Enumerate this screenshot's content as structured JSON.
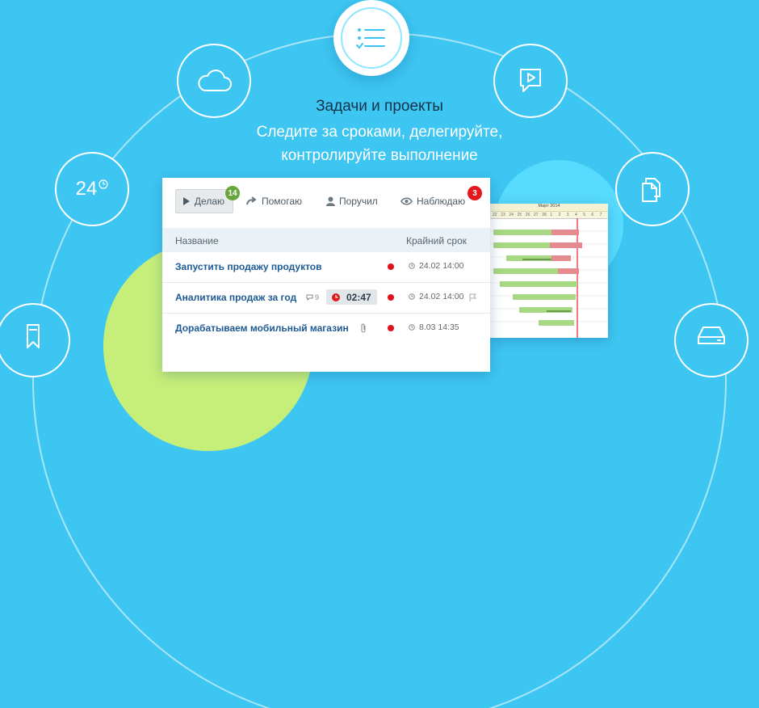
{
  "colors": {
    "background": "#3ec6f2",
    "accent_green": "#c6ef7a",
    "done_badge": "#69a53f",
    "alert_badge": "#e3171c",
    "link": "#1d5a94"
  },
  "feature": {
    "icon": "checklist-icon",
    "title": "Задачи и проекты",
    "subtitle": "Следите за сроками, делегируйте, контролируйте выполнение"
  },
  "nodes": [
    {
      "icon": "cloud-icon"
    },
    {
      "icon": "chat-play-icon"
    },
    {
      "label": "24",
      "icon": "clock-icon"
    },
    {
      "icon": "documents-icon"
    },
    {
      "icon": "bookmark-icon"
    },
    {
      "icon": "drive-icon"
    }
  ],
  "tabs": [
    {
      "label": "Делаю",
      "icon": "play-icon",
      "badge": "14",
      "active": true
    },
    {
      "label": "Помогаю",
      "icon": "arrow-icon"
    },
    {
      "label": "Поручил",
      "icon": "person-icon"
    },
    {
      "label": "Наблюдаю",
      "icon": "eye-icon",
      "badge": "3"
    }
  ],
  "table": {
    "columns": [
      "Название",
      "Крайний срок"
    ],
    "rows": [
      {
        "name": "Запустить продажу продуктов",
        "deadline": "24.02 14:00"
      },
      {
        "name": "Аналитика продаж за год",
        "comments": "9",
        "timer": "02:47",
        "deadline": "24.02 14:00"
      },
      {
        "name": "Дорабатываем мобильный магазин",
        "deadline": "8.03 14:35"
      }
    ]
  },
  "gantt": {
    "month": "Март 2014",
    "days": [
      "22",
      "23",
      "24",
      "25",
      "26",
      "27",
      "28",
      "1",
      "2",
      "3",
      "4",
      "5",
      "6",
      "7"
    ]
  }
}
